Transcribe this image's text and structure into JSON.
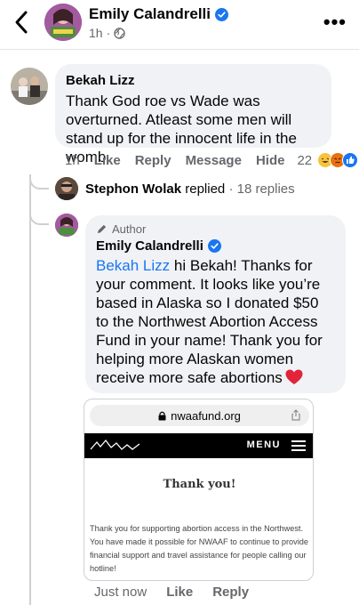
{
  "header": {
    "name": "Emily Calandrelli",
    "time": "1h",
    "verified": true
  },
  "comment1": {
    "author": "Bekah Lizz",
    "text": "Thank God roe vs Wade was overturned. Atleast some men will stand up for the innocent life in the womb.",
    "actions": {
      "time": "1h",
      "like": "Like",
      "reply": "Reply",
      "message": "Message",
      "hide": "Hide",
      "reaction_count": "22"
    }
  },
  "replies_row": {
    "name": "Stephon Wolak",
    "action": "replied",
    "separator": "·",
    "count": "18 replies"
  },
  "comment2": {
    "badge": "Author",
    "author": "Emily Calandrelli",
    "mention": "Bekah Lizz",
    "text": " hi Bekah! Thanks for your comment.  It looks like you’re based in Alaska so I donated $50 to the Northwest Abortion Access Fund in your name! Thank you for helping more Alaskan women receive more safe abortions",
    "preview": {
      "url": "nwaafund.org",
      "menu": "MENU",
      "title": "Thank you!",
      "body": "Thank you for supporting abortion access in the Northwest. You have made it possible for NWAAF to continue to provide financial support and travel assistance for people calling our hotline!"
    },
    "actions": {
      "time": "Just now",
      "like": "Like",
      "reply": "Reply"
    }
  },
  "colors": {
    "accent": "#1876f2",
    "bubble": "#f0f2f5",
    "muted": "#65676b"
  }
}
